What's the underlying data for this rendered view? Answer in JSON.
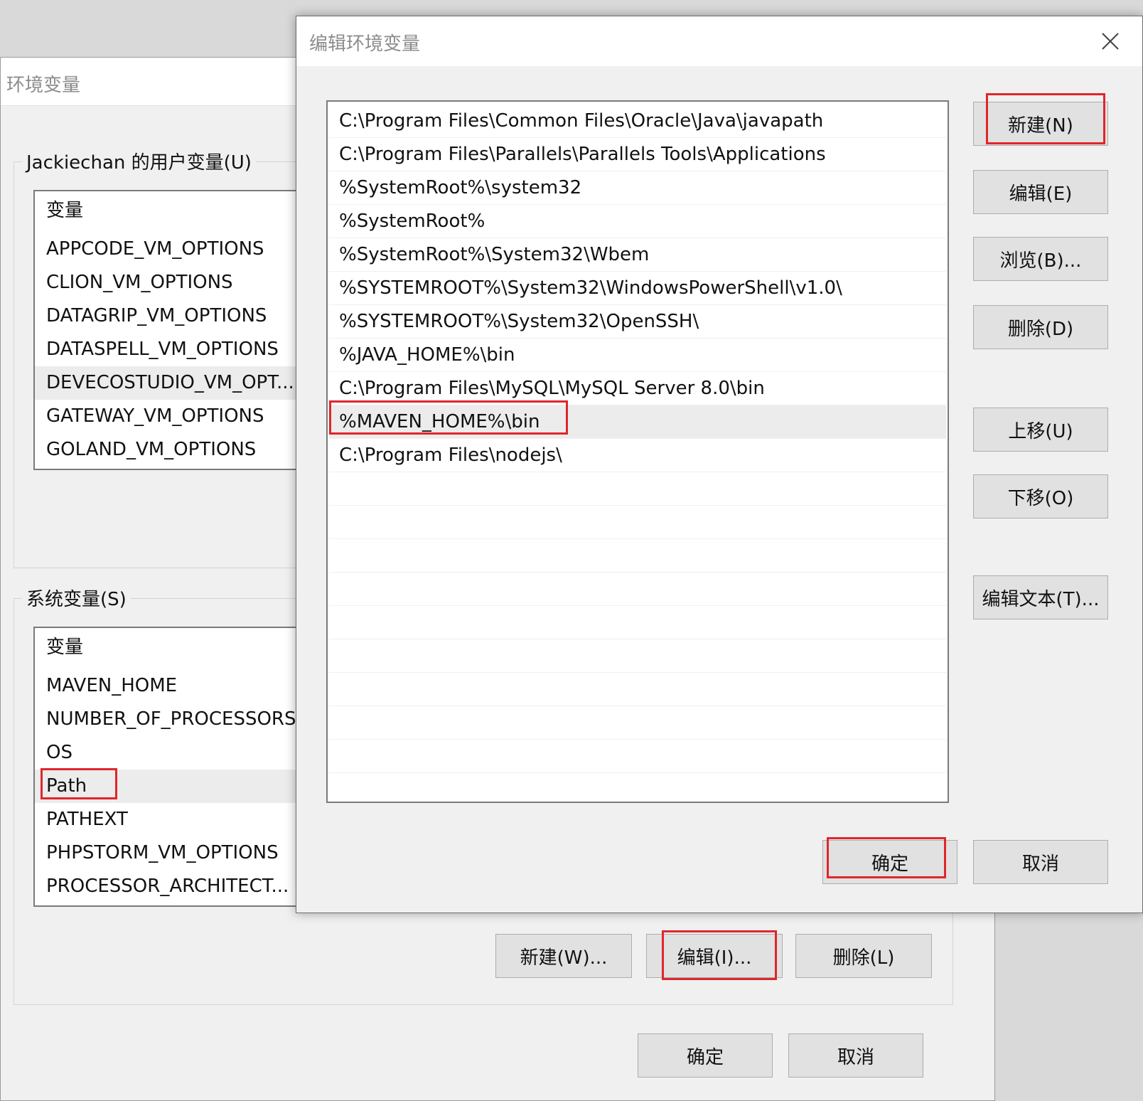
{
  "env_window": {
    "title": "环境变量",
    "user_vars": {
      "legend": "Jackiechan 的用户变量(U)",
      "header": "变量",
      "items": [
        "APPCODE_VM_OPTIONS",
        "CLION_VM_OPTIONS",
        "DATAGRIP_VM_OPTIONS",
        "DATASPELL_VM_OPTIONS",
        "DEVECOSTUDIO_VM_OPT...",
        "GATEWAY_VM_OPTIONS",
        "GOLAND_VM_OPTIONS"
      ],
      "selected": "DEVECOSTUDIO_VM_OPT..."
    },
    "system_vars": {
      "legend": "系统变量(S)",
      "header": "变量",
      "items": [
        "MAVEN_HOME",
        "NUMBER_OF_PROCESSORS",
        "OS",
        "Path",
        "PATHEXT",
        "PHPSTORM_VM_OPTIONS",
        "PROCESSOR_ARCHITECT..."
      ],
      "selected": "Path"
    },
    "buttons": {
      "new": "新建(W)...",
      "edit": "编辑(I)...",
      "delete": "删除(L)",
      "ok": "确定",
      "cancel": "取消"
    }
  },
  "edit_dialog": {
    "title": "编辑环境变量",
    "close_icon": "close-icon",
    "paths": [
      "C:\\Program Files\\Common Files\\Oracle\\Java\\javapath",
      "C:\\Program Files\\Parallels\\Parallels Tools\\Applications",
      "%SystemRoot%\\system32",
      "%SystemRoot%",
      "%SystemRoot%\\System32\\Wbem",
      "%SYSTEMROOT%\\System32\\WindowsPowerShell\\v1.0\\",
      "%SYSTEMROOT%\\System32\\OpenSSH\\",
      "%JAVA_HOME%\\bin",
      "C:\\Program Files\\MySQL\\MySQL Server 8.0\\bin",
      "%MAVEN_HOME%\\bin",
      "C:\\Program Files\\nodejs\\"
    ],
    "selected_path": "%MAVEN_HOME%\\bin",
    "buttons": {
      "new": "新建(N)",
      "edit": "编辑(E)",
      "browse": "浏览(B)...",
      "delete": "删除(D)",
      "move_up": "上移(U)",
      "move_down": "下移(O)",
      "edit_text": "编辑文本(T)...",
      "ok": "确定",
      "cancel": "取消"
    }
  },
  "colors": {
    "highlight": "#e0262b",
    "selection": "#ececec",
    "window_bg": "#f0f0f0",
    "button_bg": "#e1e1e1"
  }
}
